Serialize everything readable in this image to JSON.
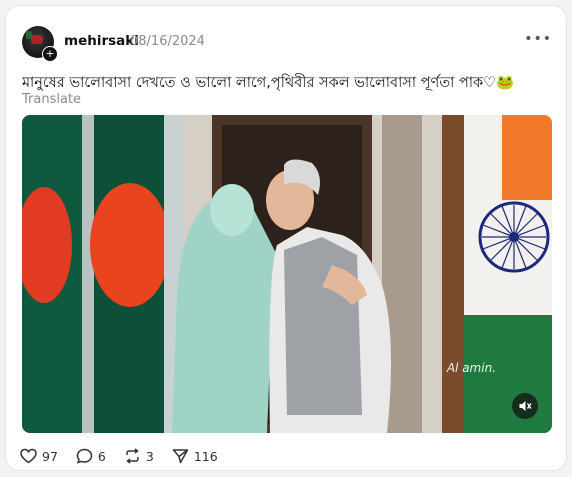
{
  "post": {
    "username": "mehirsaki",
    "date": "08/16/2024",
    "more_label": "•••",
    "caption": "মানুষের ভালোবাসা দেখতে ও ভালো লাগে,পৃথিবীর সকল ভালোবাসা পূর্ণতা পাক♡🐸",
    "translate_label": "Translate",
    "video": {
      "watermark": "Al amin.",
      "muted": true
    },
    "actions": {
      "likes": "97",
      "replies": "6",
      "reposts": "3",
      "shares": "116"
    }
  },
  "icons": {
    "like": "heart-icon",
    "reply": "comment-icon",
    "repost": "repost-icon",
    "share": "send-icon",
    "mute": "speaker-muted-icon",
    "more": "more-horizontal-icon"
  },
  "colors": {
    "text": "#101010",
    "muted_text": "#8a8a8a",
    "card_bg": "#ffffff",
    "page_bg": "#f3f3f3"
  }
}
